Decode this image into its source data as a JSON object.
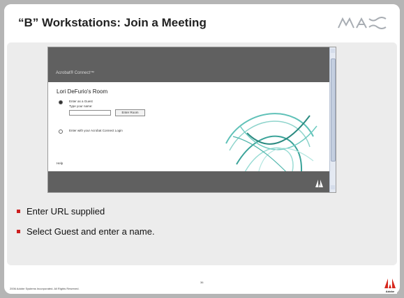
{
  "slide": {
    "title": "“B” Workstations: Join a Meeting",
    "logo_text": "MAX",
    "screenshot": {
      "brand": "Acrobat® Connect™",
      "room_title": "Lori DeFurio's Room",
      "guest_option": "Enter as a Guest",
      "name_prompt": "Type your name:",
      "name_value": "",
      "enter_button": "Enter Room",
      "login_option": "Enter with your Acrobat Connect Login",
      "help": "Help"
    },
    "bullets": [
      "Enter URL supplied",
      "Select Guest and enter a name."
    ],
    "footer": {
      "copyright": "2006 Adobe Systems Incorporated.  All Rights Reserved.",
      "page_number": "36",
      "adobe_logo_text": "Adobe"
    },
    "colors": {
      "accent": "#cc1f1f",
      "header_gray": "#606060",
      "background": "#b5b5b5"
    }
  }
}
